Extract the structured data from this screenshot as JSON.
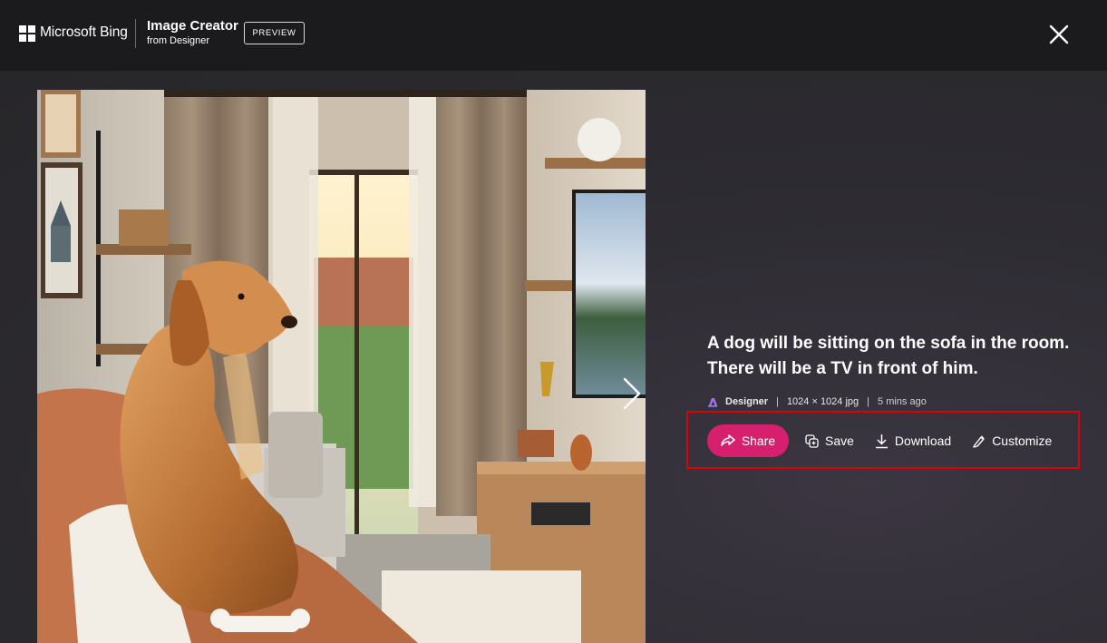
{
  "header": {
    "brand": "Microsoft Bing",
    "app_title": "Image Creator",
    "app_subtitle": "from Designer",
    "badge": "PREVIEW"
  },
  "icons": {
    "logo": "microsoft-logo",
    "close": "close-icon",
    "next": "chevron-right-icon",
    "designer": "designer-icon",
    "share": "share-icon",
    "save": "save-icon",
    "download": "download-icon",
    "customize": "customize-icon"
  },
  "image": {
    "alt": "A golden retriever sitting on a sofa in a sunlit living room facing a wall-mounted TV"
  },
  "details": {
    "prompt": "A dog will be sitting on the sofa in the room. There will be a TV in front of him.",
    "creator": "Designer",
    "dimensions": "1024 × 1024 jpg",
    "separator": "|",
    "time_ago": "5 mins ago"
  },
  "actions": {
    "share": "Share",
    "save": "Save",
    "download": "Download",
    "customize": "Customize"
  },
  "colors": {
    "accent": "#d6206e",
    "highlight_border": "#e00000",
    "header_bg": "#1b1b1d"
  }
}
